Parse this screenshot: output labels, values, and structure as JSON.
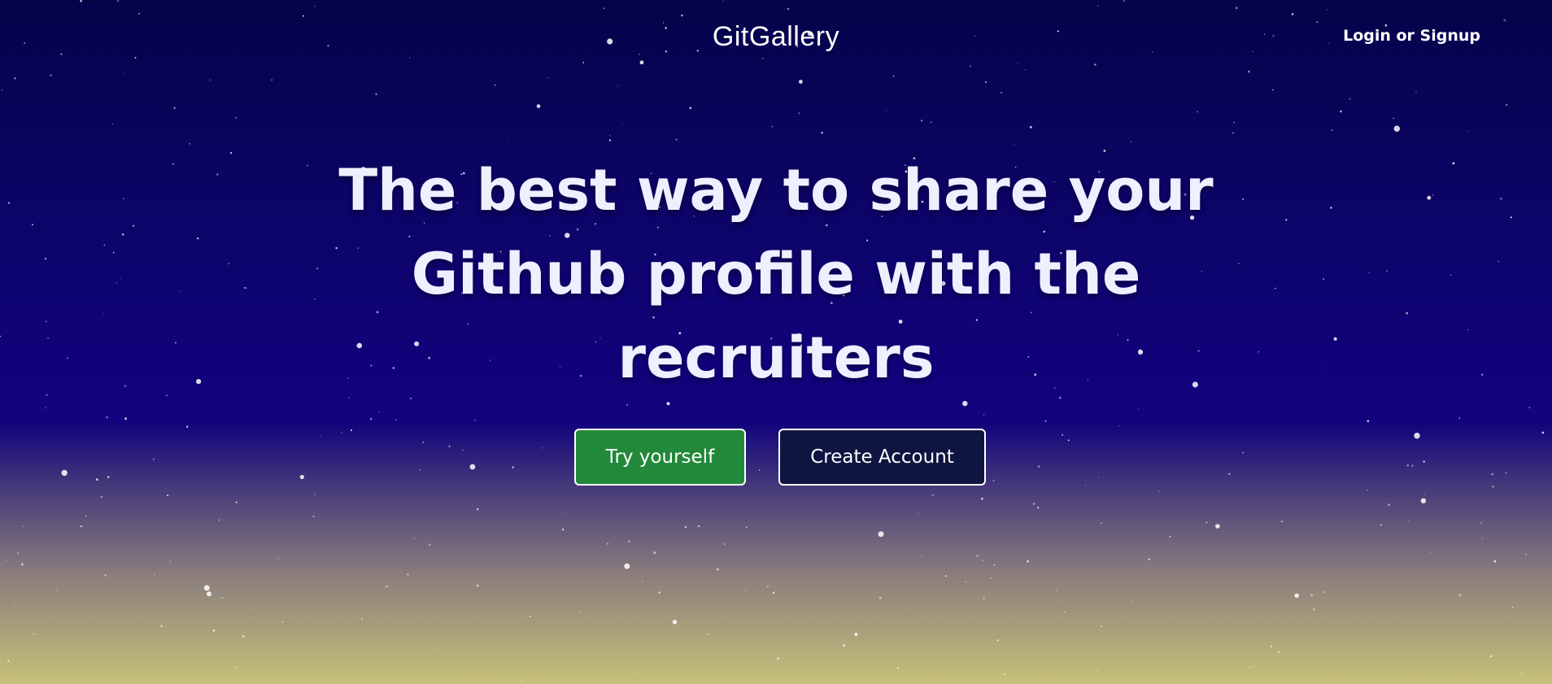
{
  "header": {
    "logo_text": "GitGallery",
    "login_link": "Login or Signup"
  },
  "hero": {
    "headline_line1": "The best way to share your",
    "headline_line2": "Github profile with the",
    "headline_line3": "recruiters"
  },
  "actions": {
    "try_label": "Try yourself",
    "create_label": "Create Account"
  },
  "colors": {
    "try_button": "#23893a",
    "create_button": "#0e1541",
    "sky_top": "#05034a",
    "sky_mid": "#10037a",
    "sky_bottom": "#c7c17a"
  }
}
